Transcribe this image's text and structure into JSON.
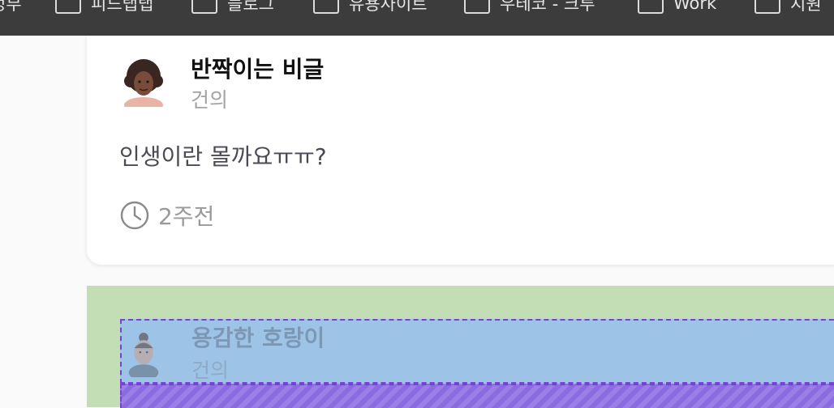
{
  "bookmarks": [
    {
      "label": "정부",
      "icon": "folder-icon"
    },
    {
      "label": "피드탭탭",
      "icon": "folder-icon"
    },
    {
      "label": "블로그",
      "icon": "folder-icon"
    },
    {
      "label": "유용사이트",
      "icon": "folder-icon"
    },
    {
      "label": "우테코 - 크루",
      "icon": "folder-icon"
    },
    {
      "label": "Work",
      "icon": "folder-icon"
    },
    {
      "label": "지원",
      "icon": "folder-icon"
    }
  ],
  "post": {
    "author": "반짝이는 비글",
    "category": "건의",
    "content": "인생이란 몰까요ㅠㅠ?",
    "time": "2주전",
    "avatar_icon": "curly-hair-avatar"
  },
  "dragging_post": {
    "author": "용감한 호랑이",
    "category": "건의",
    "avatar_icon": "bun-hair-avatar"
  },
  "colors": {
    "toolbar": "#3c3c3c",
    "drop_zone": "#c3deb4",
    "drag_item": "#9dc3e6",
    "drag_outline": "#7a3fd6"
  }
}
